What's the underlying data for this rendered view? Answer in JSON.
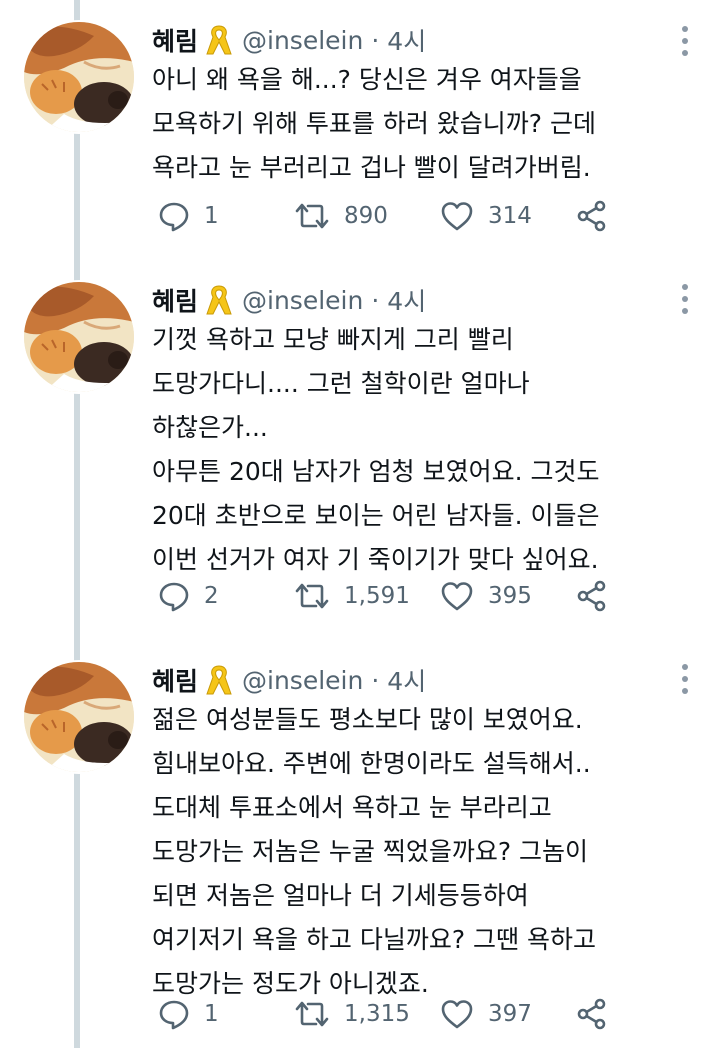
{
  "tweets": [
    {
      "name": "혜림",
      "handle": "@inselein",
      "separator": "·",
      "time": "4시",
      "text_lines": [
        "아니 왜 욕을 해...? 당신은 겨우 여자들을",
        "모욕하기 위해 투표를 하러 왔습니까? 근데",
        "욕라고 눈 부러리고 겁나 빨이 달려가버림."
      ],
      "replies": "1",
      "retweets": "890",
      "likes": "314"
    },
    {
      "name": "혜림",
      "handle": "@inselein",
      "separator": "·",
      "time": "4시",
      "text_lines": [
        "기껏 욕하고 모냥 빠지게 그리 빨리",
        "도망가다니.... 그런 철학이란 얼마나",
        "하찮은가...",
        "아무튼 20대 남자가 엄청 보였어요. 그것도",
        "20대 초반으로 보이는 어린 남자들. 이들은",
        "이번 선거가 여자 기 죽이기가 맞다 싶어요."
      ],
      "replies": "2",
      "retweets": "1,591",
      "likes": "395"
    },
    {
      "name": "혜림",
      "handle": "@inselein",
      "separator": "·",
      "time": "4시",
      "text_lines": [
        "젊은 여성분들도 평소보다 많이 보였어요.",
        "힘내보아요. 주변에 한명이라도 설득해서..",
        "도대체  투표소에서 욕하고 눈 부라리고",
        "도망가는 저놈은 누굴 찍었을까요? 그놈이",
        "되면 저놈은 얼마나 더 기세등등하여",
        "여기저기 욕을 하고 다닐까요? 그땐 욕하고",
        "도망가는 정도가 아니겠죠."
      ],
      "replies": "1",
      "retweets": "1,315",
      "likes": "397"
    }
  ],
  "icons": {
    "ribbon": "yellow-ribbon-icon",
    "reply": "reply-icon",
    "retweet": "retweet-icon",
    "like": "heart-icon",
    "share": "share-icon",
    "more": "more-icon"
  },
  "colors": {
    "text": "#0f1419",
    "secondary": "#536471",
    "thread_line": "#cfd9de",
    "ribbon": "#f5c518"
  }
}
